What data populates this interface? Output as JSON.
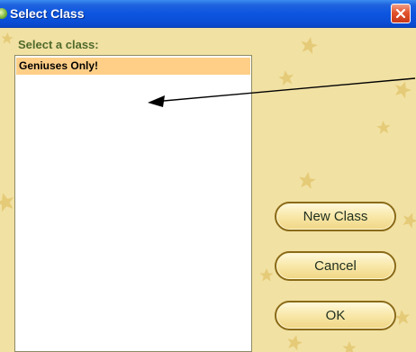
{
  "window": {
    "title": "Select Class",
    "icon": "app-icon",
    "close_icon": "close-icon"
  },
  "dialog": {
    "prompt": "Select a class:",
    "class_list": [
      {
        "label": "Geniuses Only!",
        "selected": true
      }
    ],
    "buttons": {
      "new_class": "New Class",
      "cancel": "Cancel",
      "ok": "OK"
    }
  },
  "colors": {
    "titlebar": "#0d55e0",
    "background": "#f1e1a3",
    "star": "#e3c771",
    "selected_item": "#ffcf88",
    "button_border": "#8a6a18"
  }
}
